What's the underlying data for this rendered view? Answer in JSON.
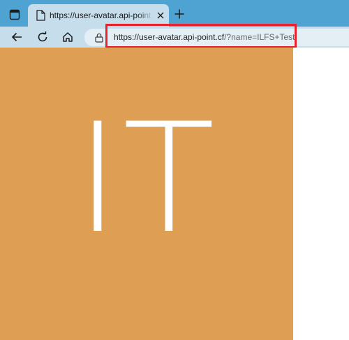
{
  "browser": {
    "tab": {
      "title": "https://user-avatar.api-point.cf/?name=ILFS+Test"
    },
    "address_bar": {
      "url_host": "https://user-avatar.api-point.cf",
      "url_path": "/?name=ILFS+Test"
    },
    "highlight_color": "#e8222c",
    "icons": {
      "tab_actions": "tab-actions-icon",
      "favicon": "page-icon",
      "close": "close-icon",
      "new_tab": "plus-icon",
      "back": "back-arrow-icon",
      "reload": "reload-icon",
      "home": "home-icon",
      "lock": "lock-icon"
    }
  },
  "content": {
    "avatar_initials": "IT",
    "avatar_background": "#de9e54",
    "avatar_text_color": "#ffffff"
  }
}
